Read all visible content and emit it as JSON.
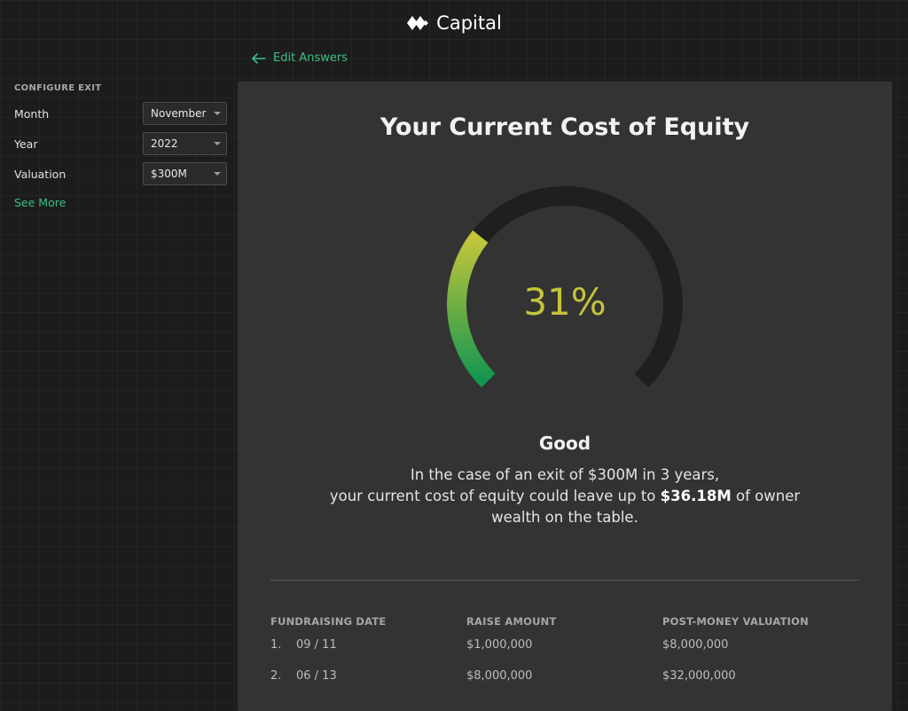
{
  "app": {
    "brand": "Capital"
  },
  "nav": {
    "back_label": "Edit Answers"
  },
  "sidebar": {
    "title": "CONFIGURE EXIT",
    "fields": [
      {
        "label": "Month",
        "value": "November"
      },
      {
        "label": "Year",
        "value": "2022"
      },
      {
        "label": "Valuation",
        "value": "$300M"
      }
    ],
    "see_more": "See More"
  },
  "card": {
    "title": "Your Current Cost of Equity",
    "gauge": {
      "value_text": "31%",
      "fraction": 0.31,
      "fill_color_start": "#129650",
      "fill_color_end": "#c5c63a",
      "track_color": "#1f1f1f"
    },
    "rating": "Good",
    "summary": {
      "line1": "In the case of an exit of $300M in 3 years,",
      "line2_pre": "your current cost of equity could leave up to",
      "amount": "$36.18M",
      "line2_post": "of owner",
      "line3": "wealth on the table."
    },
    "table": {
      "headers": [
        "FUNDRAISING DATE",
        "RAISE AMOUNT",
        "POST-MONEY VALUATION"
      ],
      "rows": [
        {
          "index": "1.",
          "date": "09 / 11",
          "raise": "$1,000,000",
          "valuation": "$8,000,000"
        },
        {
          "index": "2.",
          "date": "06 / 13",
          "raise": "$8,000,000",
          "valuation": "$32,000,000"
        }
      ]
    }
  },
  "colors": {
    "accent": "#3dbf82",
    "background": "#1c1c1c",
    "card": "#333333"
  }
}
